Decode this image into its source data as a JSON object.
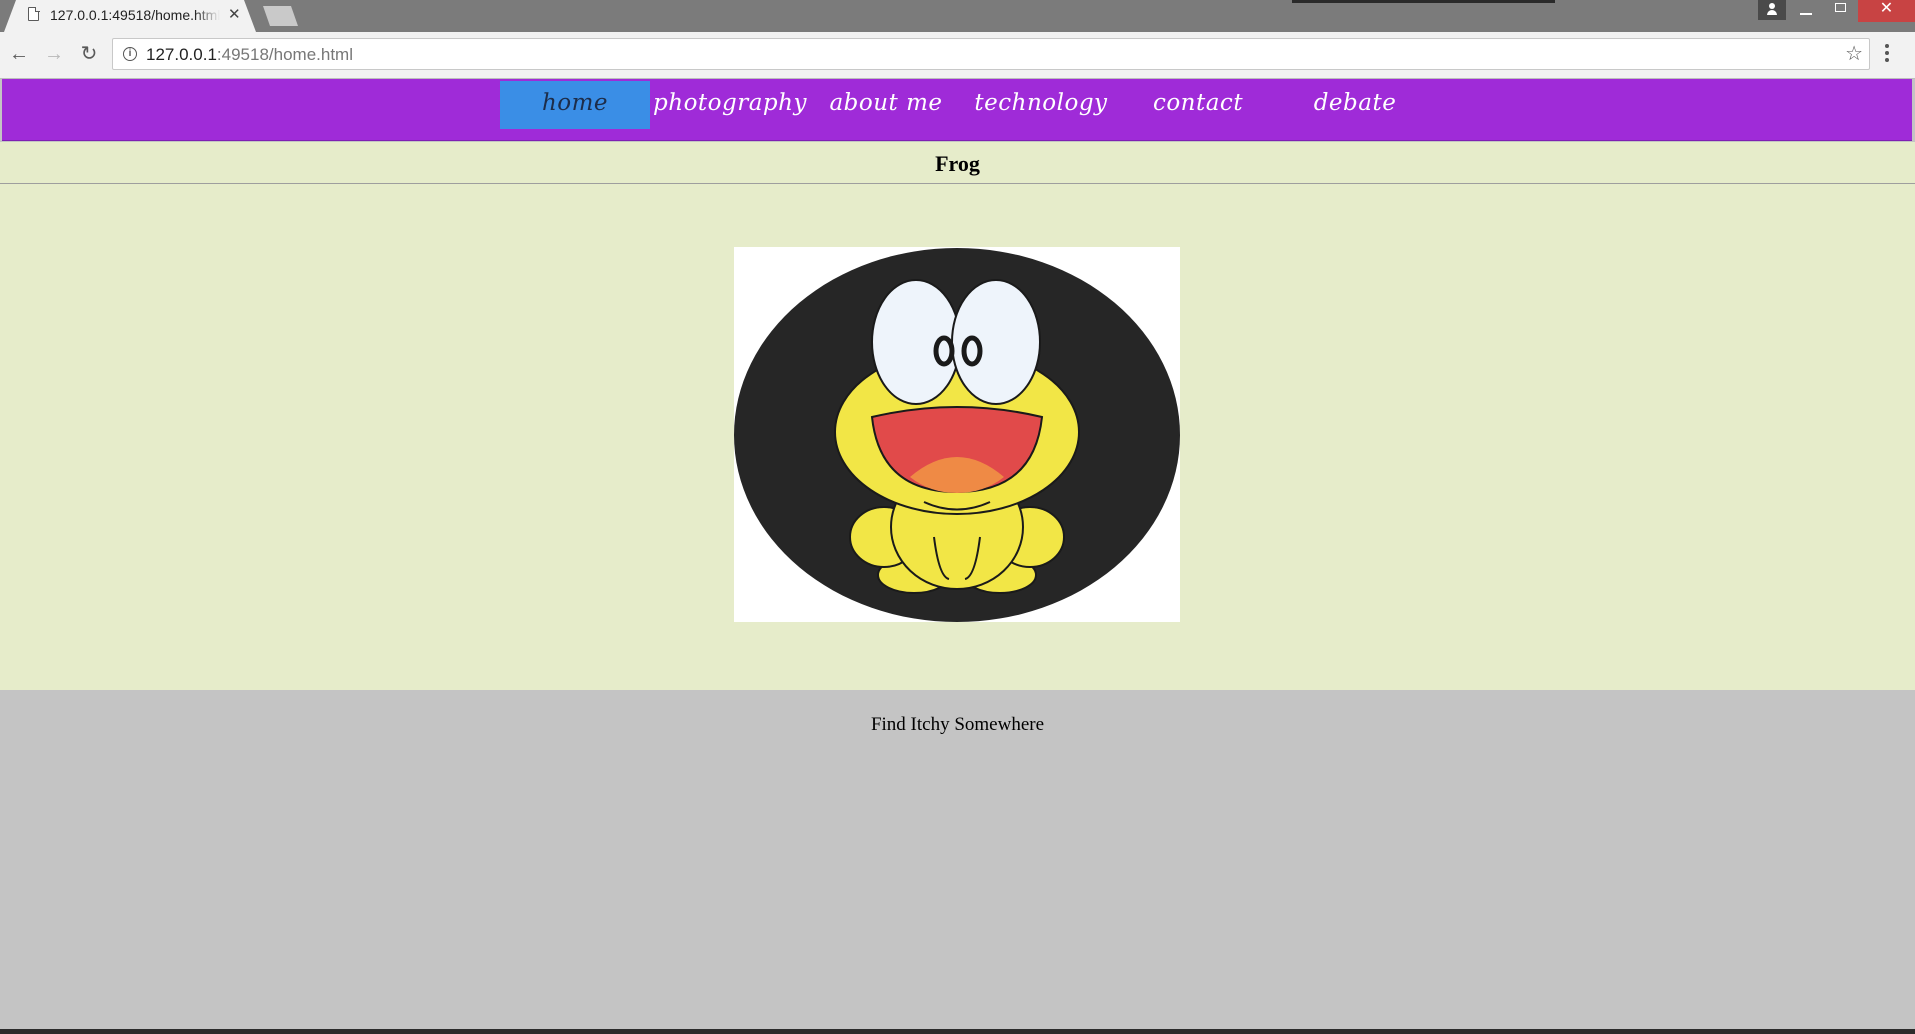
{
  "browser": {
    "tab_title": "127.0.0.1:49518/home.html",
    "close_glyph": "✕",
    "url_host": "127.0.0.1",
    "url_rest": ":49518/home.html"
  },
  "site_nav": {
    "items": [
      {
        "label": "home",
        "active": true
      },
      {
        "label": "photography"
      },
      {
        "label": "about me"
      },
      {
        "label": "technology"
      },
      {
        "label": "contact"
      },
      {
        "label": "debate"
      }
    ]
  },
  "main": {
    "title": "Frog"
  },
  "footer": {
    "text": "Find Itchy Somewhere"
  },
  "colors": {
    "nav_bg": "#9f2bd8",
    "nav_active": "#3a8ee6",
    "content_bg": "#e6ecca",
    "footer_bg": "#c4c4c4",
    "frog_yellow": "#f2e646",
    "frog_mouth": "#e14a4a",
    "frog_tongue": "#ef8a45"
  }
}
